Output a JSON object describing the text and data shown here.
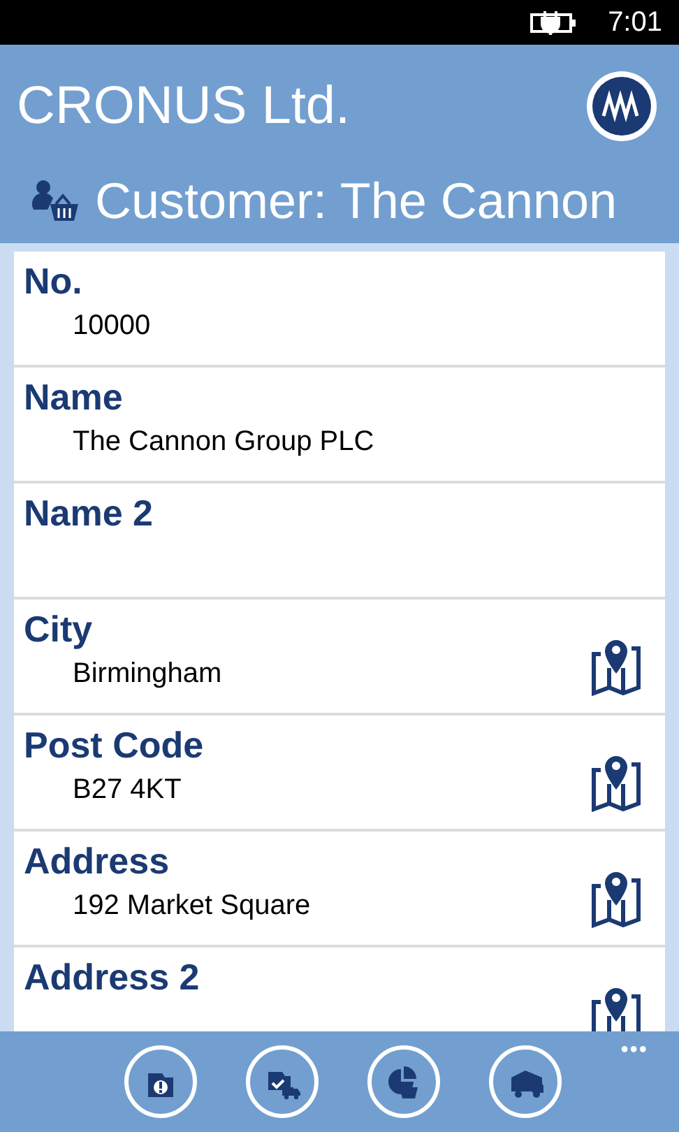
{
  "status_bar": {
    "time": "7:01"
  },
  "header": {
    "title": "CRONUS Ltd.",
    "subtitle": "Customer: The Cannon"
  },
  "fields": [
    {
      "label": "No.",
      "value": "10000",
      "kind": "text"
    },
    {
      "label": "Name",
      "value": "The Cannon Group PLC",
      "kind": "text"
    },
    {
      "label": "Name 2",
      "kind": "text"
    },
    {
      "label": "City",
      "value": "Birmingham",
      "kind": "location"
    },
    {
      "label": "Post Code",
      "value": "B27 4KT",
      "kind": "location"
    },
    {
      "label": "Address",
      "value": "192 Market Square",
      "kind": "location"
    },
    {
      "label": "Address 2",
      "kind": "location"
    }
  ],
  "app_bar": {
    "buttons": [
      {
        "kind": "info"
      },
      {
        "kind": "shipment"
      },
      {
        "kind": "statistics"
      },
      {
        "kind": "delivery"
      }
    ],
    "more": "•••"
  }
}
